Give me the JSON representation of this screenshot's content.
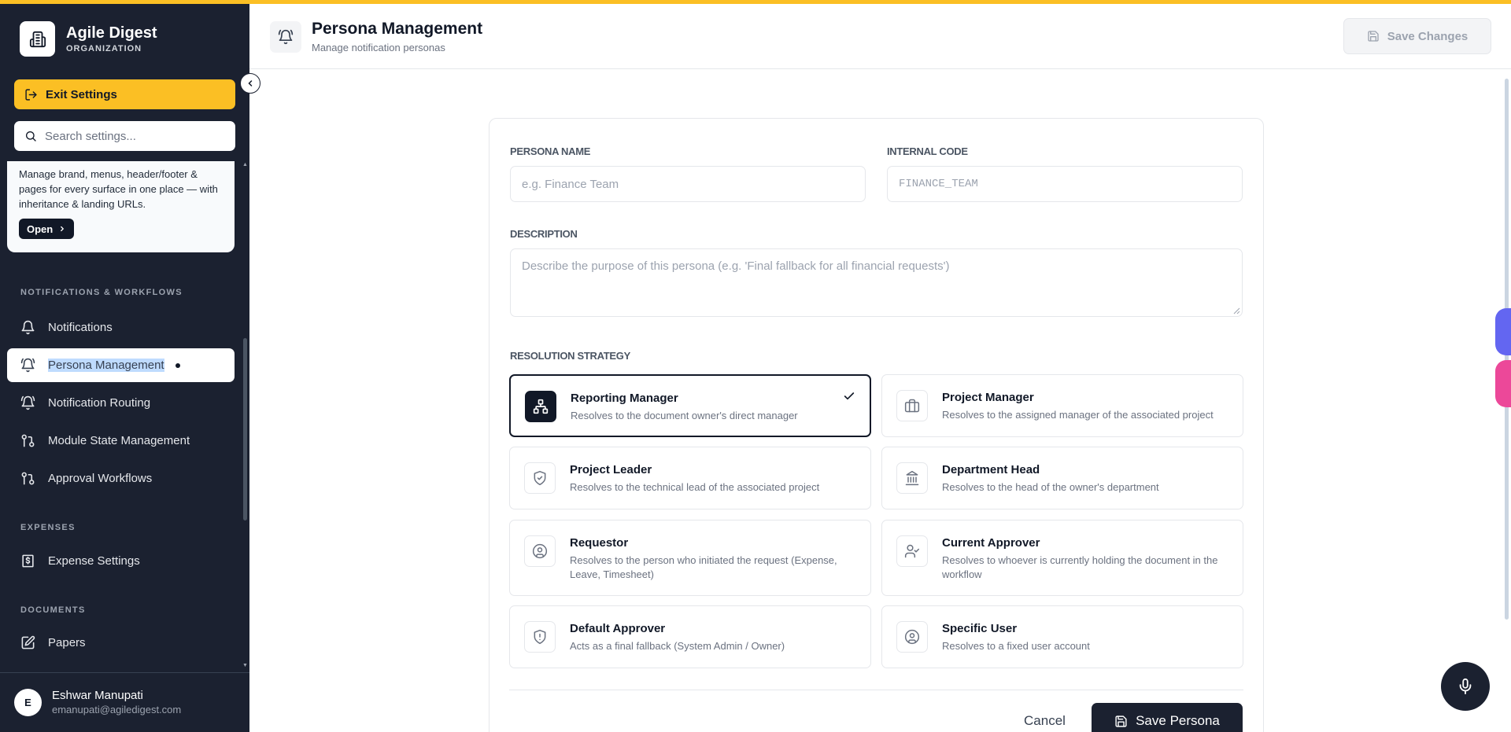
{
  "colors": {
    "sidebar_bg": "#1b2130",
    "accent": "#fbbf24",
    "primary": "#1b2130"
  },
  "org": {
    "name": "Agile Digest",
    "type": "ORGANIZATION"
  },
  "sidebar": {
    "exit_label": "Exit Settings",
    "search_placeholder": "Search settings...",
    "promo": {
      "text": "Manage brand, menus, header/footer & pages for every surface in one place — with inheritance & landing URLs.",
      "button": "Open"
    },
    "sections": [
      {
        "title": "NOTIFICATIONS & WORKFLOWS",
        "items": [
          "Notifications",
          "Persona Management",
          "Notification Routing",
          "Module State Management",
          "Approval Workflows"
        ]
      },
      {
        "title": "EXPENSES",
        "items": [
          "Expense Settings"
        ]
      },
      {
        "title": "DOCUMENTS",
        "items": [
          "Papers"
        ]
      }
    ],
    "active_item": "Persona Management",
    "user": {
      "initial": "E",
      "name": "Eshwar Manupati",
      "email": "emanupati@agiledigest.com"
    }
  },
  "header": {
    "title": "Persona Management",
    "subtitle": "Manage notification personas",
    "save_label": "Save Changes"
  },
  "form": {
    "name_label": "PERSONA NAME",
    "name_placeholder": "e.g. Finance Team",
    "code_label": "INTERNAL CODE",
    "code_placeholder": "FINANCE_TEAM",
    "description_label": "DESCRIPTION",
    "description_placeholder": "Describe the purpose of this persona (e.g. 'Final fallback for all financial requests')",
    "strategy_label": "RESOLUTION STRATEGY",
    "strategies": [
      {
        "title": "Reporting Manager",
        "desc": "Resolves to the document owner's direct manager",
        "icon": "org-chart-icon",
        "selected": true
      },
      {
        "title": "Project Manager",
        "desc": "Resolves to the assigned manager of the associated project",
        "icon": "briefcase-icon",
        "selected": false
      },
      {
        "title": "Project Leader",
        "desc": "Resolves to the technical lead of the associated project",
        "icon": "shield-check-icon",
        "selected": false
      },
      {
        "title": "Department Head",
        "desc": "Resolves to the head of the owner's department",
        "icon": "building-icon",
        "selected": false
      },
      {
        "title": "Requestor",
        "desc": "Resolves to the person who initiated the request (Expense, Leave, Timesheet)",
        "icon": "user-circle-icon",
        "selected": false
      },
      {
        "title": "Current Approver",
        "desc": "Resolves to whoever is currently holding the document in the workflow",
        "icon": "user-check-icon",
        "selected": false
      },
      {
        "title": "Default Approver",
        "desc": "Acts as a final fallback (System Admin / Owner)",
        "icon": "shield-alert-icon",
        "selected": false
      },
      {
        "title": "Specific User",
        "desc": "Resolves to a fixed user account",
        "icon": "user-circle-icon",
        "selected": false
      }
    ],
    "cancel_label": "Cancel",
    "submit_label": "Save Persona"
  }
}
